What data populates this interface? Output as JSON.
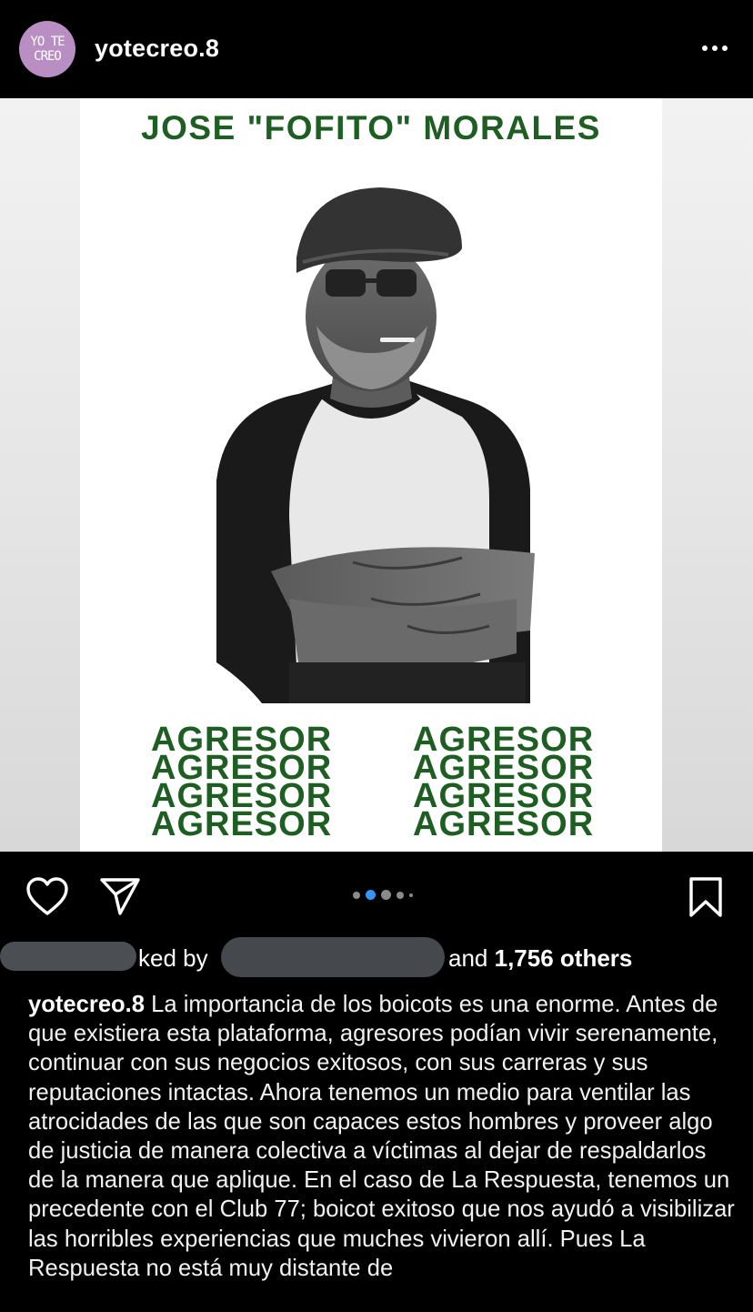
{
  "header": {
    "avatar_text_line1": "YO TE",
    "avatar_text_line2": "CREO",
    "username": "yotecreo.8",
    "more_icon": "more-horizontal-icon"
  },
  "post": {
    "title": "JOSE \"FOFITO\" MORALES",
    "agresor_left": [
      "AGRESOR",
      "AGRESOR",
      "AGRESOR",
      "AGRESOR"
    ],
    "agresor_right": [
      "AGRESOR",
      "AGRESOR",
      "AGRESOR",
      "AGRESOR"
    ],
    "accent_color": "#1e5e23"
  },
  "actions": {
    "like_icon": "heart-icon",
    "share_icon": "send-icon",
    "save_icon": "bookmark-icon",
    "carousel_total": 5,
    "carousel_active": 2,
    "active_dot_color": "#3797f0"
  },
  "likes": {
    "liked_by_text": "ked by",
    "and_text": "and",
    "count_text": "1,756 others"
  },
  "caption": {
    "username": "yotecreo.8",
    "text": "La importancia de los boicots es una enorme. Antes de que existiera esta plataforma, agresores podían vivir serenamente, continuar con sus negocios exitosos, con sus carreras y sus reputaciones intactas. Ahora tenemos un medio para ventilar las atrocidades de las que son capaces estos hombres y proveer algo de justicia de manera colectiva a víctimas al dejar de respaldarlos de la manera que aplique. En el caso de La Respuesta, tenemos un precedente con el Club 77; boicot exitoso que nos ayudó a visibilizar las horribles experiencias que muches vivieron allí. Pues La Respuesta no está muy distante de"
  }
}
